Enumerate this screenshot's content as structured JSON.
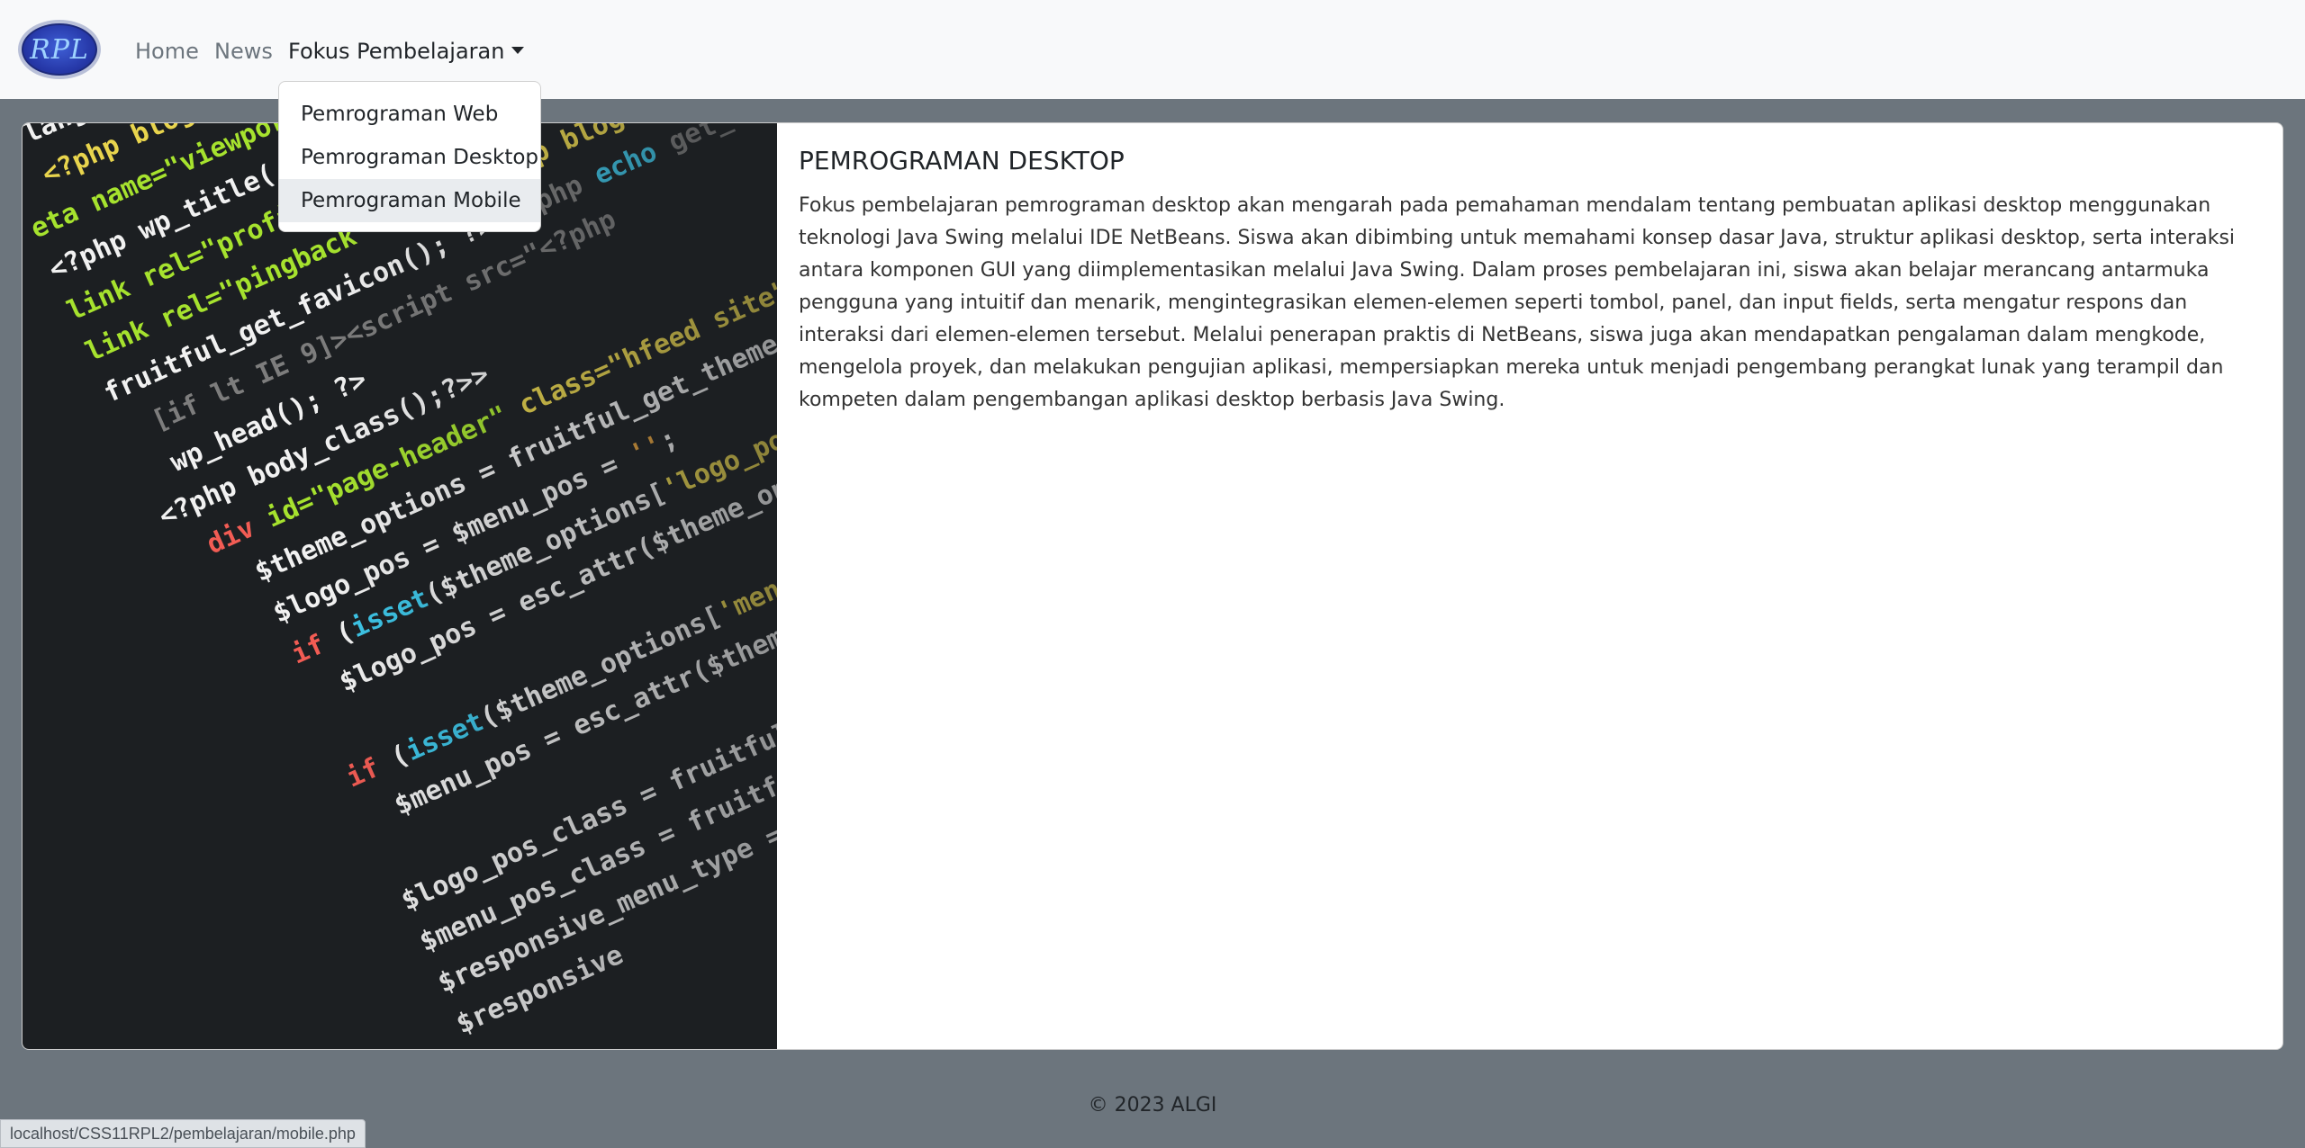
{
  "navbar": {
    "logo_text": "RPL",
    "items": [
      {
        "label": "Home"
      },
      {
        "label": "News"
      },
      {
        "label": "Fokus Pembelajaran"
      }
    ],
    "dropdown": [
      {
        "label": "Pemrograman Web"
      },
      {
        "label": "Pemrograman Desktop"
      },
      {
        "label": "Pemrograman Mobile"
      }
    ]
  },
  "card": {
    "title": "PEMROGRAMAN DESKTOP",
    "body": "Fokus pembelajaran pemrograman desktop akan mengarah pada pemahaman mendalam tentang pembuatan aplikasi desktop menggunakan teknologi Java Swing melalui IDE NetBeans. Siswa akan dibimbing untuk memahami konsep dasar Java, struktur aplikasi desktop, serta interaksi antara komponen GUI yang diimplementasikan melalui Java Swing. Dalam proses pembelajaran ini, siswa akan belajar merancang antarmuka pengguna yang intuitif dan menarik, mengintegrasikan elemen-elemen seperti tombol, panel, dan input fields, serta mengatur respons dan interaksi dari elemen-elemen tersebut. Melalui penerapan praktis di NetBeans, siswa juga akan mendapatkan pengalaman dalam mengkode, mengelola proyek, dan melakukan pengujian aplikasi, mempersiapkan mereka untuk menjadi pengembang perangkat lunak yang terampil dan kompeten dalam pengembangan aplikasi desktop berbasis Java Swing."
  },
  "footer": {
    "text": "© 2023 ALGI"
  },
  "status_bar": {
    "url": "localhost/CSS11RPL2/pembelajaran/mobile.php"
  },
  "colors": {
    "navbar_bg": "#f8f9fa",
    "page_bg": "#6c757d",
    "card_bg": "#ffffff"
  }
}
